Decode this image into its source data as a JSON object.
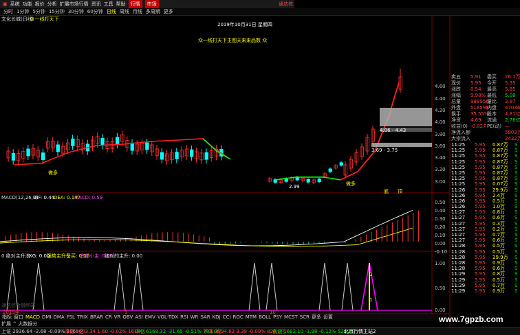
{
  "menu": {
    "items": [
      "系统",
      "功能",
      "报价",
      "分析",
      "扩展市场行情",
      "资讯",
      "工具",
      "帮助"
    ],
    "tabs": [
      "行情",
      "市场"
    ],
    "right_label": "通达信"
  },
  "periods": {
    "items": [
      "分时",
      "1分钟",
      "5分钟",
      "15分钟",
      "30分钟",
      "60分钟",
      "日线",
      "周线",
      "月线",
      "多周期",
      "更多"
    ],
    "active": "日线"
  },
  "stock": {
    "name_line": "文化长城(日线)",
    "indicator_label": "0 一线打天下",
    "date_label": "2019年10月31日 星期四",
    "banner": "众一线打天下主图天来来品数 众"
  },
  "annotations": {
    "box_upper": "4.06 - 4.43",
    "box_lower": "3.69 - 3.75",
    "low_price": "2.99",
    "marker_buy1": "做多",
    "marker_buy2": "做多",
    "marker_b1": "底",
    "marker_b2": "顶"
  },
  "price_axis": [
    "4.60",
    "4.40",
    "4.20",
    "4.00",
    "3.80",
    "3.60",
    "3.40",
    "3.20",
    "3.00"
  ],
  "macd": {
    "label": "MACD(12,26,9)",
    "dif": "DIF: 0.44",
    "dea": "DEA: 0.147",
    "macd": "MACD: 0.59",
    "axis": [
      "0.50",
      "0.40",
      "0.30",
      "0.20",
      "0.10",
      "0.00",
      "-0.10"
    ]
  },
  "osc": {
    "label": "0 绝对主升浪",
    "xg": "XG: 0.00",
    "l1": "强势主升备买: 0.00",
    "l2": "底部小主: 0.00",
    "l3": "绝对的主升: 0.00",
    "axis": [
      "1.00",
      "0.50",
      "0.00"
    ],
    "marker_top": "1",
    "marker_mid": "1",
    "year_label": "2019年",
    "month1": "9",
    "month2": "10",
    "watermark_small": "通达信金融终端"
  },
  "quote": {
    "top": [
      {
        "label": "卖五",
        "val": "5.91",
        "lab2": "委买",
        "val2": "26.1万"
      },
      {
        "label": "现价",
        "val": "5.95",
        "lab2": "今开",
        "val2": "5.35"
      },
      {
        "label": "涨跌",
        "val": "0.54",
        "lab2": "最高",
        "val2": "5.95"
      },
      {
        "label": "涨幅",
        "val": "9.98%",
        "lab2": "最低",
        "val2": "5.08"
      },
      {
        "label": "总量",
        "val": "988956",
        "lab2": "量比",
        "val2": "3.87"
      },
      {
        "label": "外盘",
        "val": "518598",
        "lab2": "内盘",
        "val2": "470365"
      },
      {
        "label": "换手",
        "val": "35.55%",
        "lab2": "股本",
        "val2": "4.81亿"
      },
      {
        "label": "净资",
        "val": "4.69",
        "lab2": "流通",
        "val2": "2.78亿"
      },
      {
        "label": "收益(0)",
        "val": "-0.027",
        "lab2": "PE(动)",
        "val2": "—"
      },
      {
        "label": "净流入额",
        "val": "",
        "lab2": "",
        "val2": "5803万"
      },
      {
        "label": "大宗流入",
        "val": "",
        "lab2": "",
        "val2": "2432万"
      }
    ],
    "ticks": [
      {
        "t": "11:25",
        "p": "5.95",
        "v": "0.87万",
        "s": "S"
      },
      {
        "t": "11:25",
        "p": "5.95",
        "v": "0.87万",
        "s": "S"
      },
      {
        "t": "11:25",
        "p": "5.95",
        "v": "0.87万",
        "s": "S"
      },
      {
        "t": "11:25",
        "p": "5.95",
        "v": "0.87万",
        "s": "S"
      },
      {
        "t": "11:25",
        "p": "5.95",
        "v": "0.87万",
        "s": "S"
      },
      {
        "t": "11:25",
        "p": "5.95",
        "v": "0.87万",
        "s": "S"
      },
      {
        "t": "11:25",
        "p": "5.95",
        "v": "0.87万",
        "s": "S"
      },
      {
        "t": "11:25",
        "p": "5.95",
        "v": "0.07万",
        "s": "S"
      },
      {
        "t": "11:26",
        "p": "5.95",
        "v": "29.9万",
        "s": "S"
      },
      {
        "t": "11:26",
        "p": "5.95",
        "v": "2.4万",
        "s": "S"
      },
      {
        "t": "11:26",
        "p": "5.95",
        "v": "0.5万",
        "s": "S"
      },
      {
        "t": "11:26",
        "p": "5.95",
        "v": "1.0万",
        "s": "S"
      },
      {
        "t": "11:27",
        "p": "5.95",
        "v": "0.8万",
        "s": "S"
      },
      {
        "t": "11:27",
        "p": "5.95",
        "v": "0.6万",
        "s": "S"
      },
      {
        "t": "11:27",
        "p": "5.95",
        "v": "0.3万",
        "s": "S"
      },
      {
        "t": "11:27",
        "p": "5.95",
        "v": "0.2万",
        "s": "S"
      },
      {
        "t": "11:27",
        "p": "5.95",
        "v": "0.7万",
        "s": "S"
      },
      {
        "t": "11:27",
        "p": "5.95",
        "v": "0.6万",
        "s": "S"
      },
      {
        "t": "11:28",
        "p": "5.95",
        "v": "0.5万",
        "s": "S"
      },
      {
        "t": "11:28",
        "p": "5.95",
        "v": "0.5万",
        "s": "S"
      },
      {
        "t": "11:28",
        "p": "5.95",
        "v": "29.9万",
        "s": "S"
      },
      {
        "t": "11:28",
        "p": "5.95",
        "v": "0.9万",
        "s": "S"
      },
      {
        "t": "11:28",
        "p": "5.95",
        "v": "0.6万",
        "s": "S"
      },
      {
        "t": "11:29",
        "p": "5.95",
        "v": "0.8万",
        "s": "S"
      },
      {
        "t": "11:29",
        "p": "5.95",
        "v": "0.5万",
        "s": "S"
      },
      {
        "t": "11:29",
        "p": "5.95",
        "v": "0.7万",
        "s": "S"
      },
      {
        "t": "11:29",
        "p": "5.95",
        "v": "0.9万",
        "s": "S"
      }
    ]
  },
  "bottom_tabs": {
    "items": [
      "指标",
      "窗口",
      "MACD",
      "DMI",
      "DMA",
      "FSL",
      "TRIX",
      "BRAR",
      "CR",
      "VR",
      "OBV",
      "ASI",
      "EMV",
      "VOL-TDX",
      "RSI",
      "WR",
      "SAR",
      "KDJ",
      "CCI",
      "ROC",
      "MTM",
      "BOLL",
      "PSY",
      "MCST",
      "SCR",
      "更多",
      "设置"
    ],
    "selected": "MACD",
    "sub_line": "扩展 ^ 大数据分"
  },
  "status": {
    "sh": "上证 2936.64 -2.68 -0.09% 1065亿",
    "sz": "深证 9603.34 1.60 -0.02% 1618亿",
    "zx": "中小 6168.32 -31.65 -0.51% 703.0亿",
    "hs": "沪深 3894.62 3.39 -0.09% 826.2亿",
    "cy": "创业 1682.10 -1.98 -0.12% 526.2亿",
    "right": "北京行情主站2"
  },
  "watermark": "www.7gpzb.com"
}
